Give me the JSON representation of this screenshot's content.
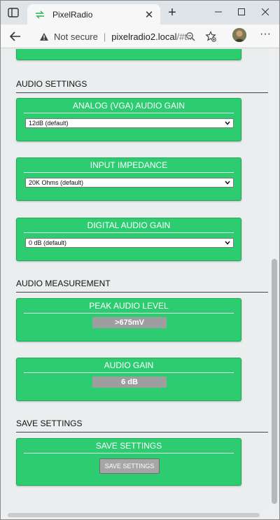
{
  "browser": {
    "tab_title": "PixelRadio",
    "security_label": "Not secure",
    "url_host": "pixelradio2.local",
    "url_path": "/#t...",
    "colors": {
      "accent": "#2ecc71",
      "tab_icon": "#3fbf6a"
    }
  },
  "sections": [
    {
      "heading": "AUDIO SETTINGS",
      "cards": [
        {
          "title": "ANALOG (VGA) AUDIO GAIN",
          "type": "select",
          "value": "12dB (default)"
        },
        {
          "title": "INPUT IMPEDANCE",
          "type": "select",
          "value": "20K Ohms (default)"
        },
        {
          "title": "DIGITAL AUDIO GAIN",
          "type": "select",
          "value": "0 dB (default)"
        }
      ]
    },
    {
      "heading": "AUDIO MEASUREMENT",
      "cards": [
        {
          "title": "PEAK AUDIO LEVEL",
          "type": "readout",
          "value": ">675mV"
        },
        {
          "title": "AUDIO GAIN",
          "type": "readout",
          "value": "6 dB"
        }
      ]
    },
    {
      "heading": "SAVE SETTINGS",
      "cards": [
        {
          "title": "SAVE SETTINGS",
          "type": "button",
          "value": "SAVE SETTINGS"
        }
      ]
    }
  ]
}
